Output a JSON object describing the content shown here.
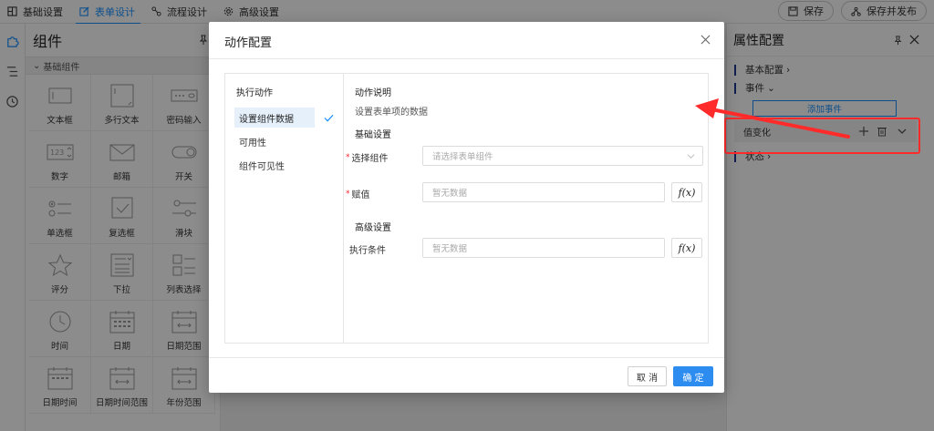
{
  "top_tabs": [
    {
      "label": "基础设置",
      "icon": "grid-icon"
    },
    {
      "label": "表单设计",
      "icon": "edit-icon"
    },
    {
      "label": "流程设计",
      "icon": "flow-icon"
    },
    {
      "label": "高级设置",
      "icon": "gear-icon"
    }
  ],
  "top_actions": {
    "save": "保存",
    "save_publish": "保存并发布"
  },
  "component_panel": {
    "title": "组件",
    "group": "基础组件",
    "items": [
      {
        "label": "文本框",
        "icon": "textbox-icon"
      },
      {
        "label": "多行文本",
        "icon": "textarea-icon"
      },
      {
        "label": "密码输入",
        "icon": "password-icon"
      },
      {
        "label": "数字",
        "icon": "number-icon"
      },
      {
        "label": "邮箱",
        "icon": "email-icon"
      },
      {
        "label": "开关",
        "icon": "switch-icon"
      },
      {
        "label": "单选框",
        "icon": "radio-icon"
      },
      {
        "label": "复选框",
        "icon": "checkbox-icon"
      },
      {
        "label": "滑块",
        "icon": "slider-icon"
      },
      {
        "label": "评分",
        "icon": "star-icon"
      },
      {
        "label": "下拉",
        "icon": "dropdown-icon"
      },
      {
        "label": "列表选择",
        "icon": "list-select-icon"
      },
      {
        "label": "时间",
        "icon": "clock-icon"
      },
      {
        "label": "日期",
        "icon": "calendar-icon"
      },
      {
        "label": "日期范围",
        "icon": "date-range-icon"
      },
      {
        "label": "日期时间",
        "icon": "datetime-icon"
      },
      {
        "label": "日期时间范围",
        "icon": "datetime-range-icon"
      },
      {
        "label": "年份范围",
        "icon": "year-range-icon"
      }
    ],
    "number_icon_text": "123"
  },
  "property_panel": {
    "title": "属性配置",
    "basic_config": "基本配置",
    "events": "事件",
    "add_event": "添加事件",
    "event_name": "值变化",
    "state": "状态"
  },
  "modal": {
    "title": "动作配置",
    "action_list_title": "执行动作",
    "actions": [
      "设置组件数据",
      "可用性",
      "组件可见性"
    ],
    "selected_action": "设置组件数据",
    "desc_title": "动作说明",
    "desc_text": "设置表单项的数据",
    "basic_title": "基础设置",
    "select_component_label": "选择组件",
    "select_component_placeholder": "请选择表单组件",
    "assign_label": "赋值",
    "assign_placeholder": "暂无数据",
    "advanced_title": "高级设置",
    "condition_label": "执行条件",
    "condition_placeholder": "暂无数据",
    "fx_label": "f(x)",
    "cancel": "取 消",
    "confirm": "确 定"
  },
  "colors": {
    "accent": "#1890ff",
    "primary_button": "#2d8cf0",
    "annotation": "#ff2a2a"
  }
}
